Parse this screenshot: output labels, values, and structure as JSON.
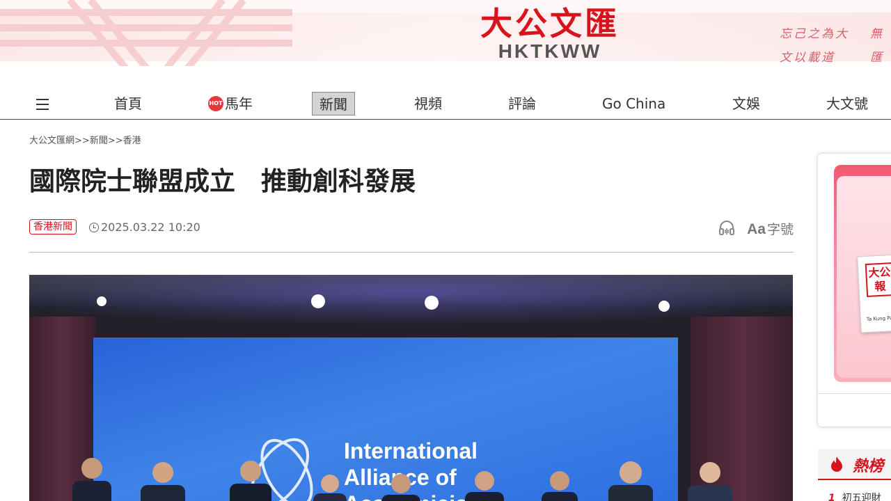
{
  "header": {
    "logo_cn": "大公文匯",
    "logo_en": "HKTKWW",
    "calligraphy_col1_top": "忘己之為大",
    "calligraphy_col1_bottom": "文以載道",
    "calligraphy_col2_top": "無",
    "calligraphy_col2_bottom": "匯"
  },
  "nav": {
    "items": [
      {
        "label": "首頁"
      },
      {
        "label": "馬年",
        "badge": "HOT"
      },
      {
        "label": "新聞",
        "active": true
      },
      {
        "label": "視頻"
      },
      {
        "label": "評論"
      },
      {
        "label": "Go China"
      },
      {
        "label": "文娛"
      },
      {
        "label": "大文號"
      }
    ]
  },
  "breadcrumb": {
    "items": [
      "大公文匯網",
      ">>",
      "新聞",
      ">>",
      "香港"
    ]
  },
  "article": {
    "title": "國際院士聯盟成立　推動創科發展",
    "tag": "香港新聞",
    "datetime": "2025.03.22 10:20",
    "font_tool_label": "字號",
    "font_tool_glyph": "Aa",
    "photo": {
      "screen_line1": "International",
      "screen_line2": "Alliance of",
      "screen_line3": "Academicians"
    }
  },
  "sidebar": {
    "promo_paper": "大公報",
    "promo_paper_en": "Ta Kung Pao",
    "hot_title": "熱榜",
    "hot_list": [
      {
        "rank": "1",
        "text": "初五迎財"
      }
    ]
  },
  "colors": {
    "brand_red": "#d7141e",
    "nav_active_bg": "#d3d3d3",
    "hot_badge": "#e8373c"
  }
}
